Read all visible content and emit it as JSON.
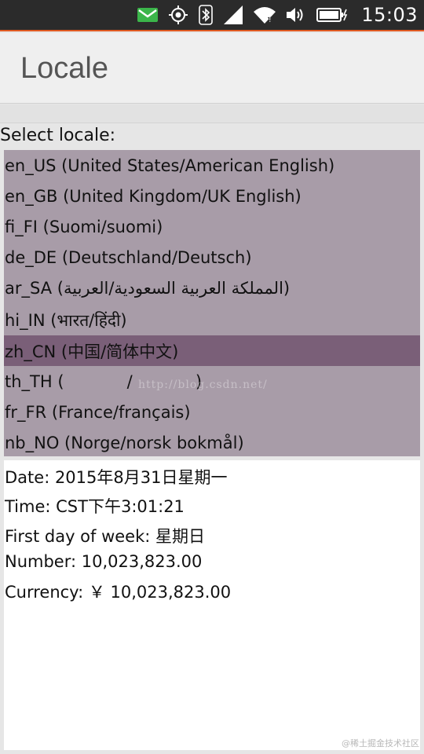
{
  "status_bar": {
    "time": "15:03",
    "icons": [
      "message-icon",
      "location-icon",
      "bluetooth-icon",
      "signal-icon",
      "wifi-icon",
      "volume-icon",
      "battery-icon"
    ],
    "message_color": "#3bb54a"
  },
  "header": {
    "title": "Locale"
  },
  "select_label": "Select locale:",
  "locales": [
    {
      "label": "en_US (United States/American English)"
    },
    {
      "label": "en_GB (United Kingdom/UK English)"
    },
    {
      "label": "fi_FI (Suomi/suomi)"
    },
    {
      "label": "de_DE (Deutschland/Deutsch)"
    },
    {
      "label": "ar_SA (المملكة العربية السعودية/العربية)"
    },
    {
      "label": "hi_IN (भारत/हिंदी)"
    },
    {
      "label": "zh_CN (中国/简体中文)",
      "selected": true
    },
    {
      "label": "th_TH (            /            )"
    },
    {
      "label": "fr_FR (France/français)"
    },
    {
      "label": "nb_NO (Norge/norsk bokmål)"
    }
  ],
  "info": {
    "date": "Date: 2015年8月31日星期一",
    "time": "Time: CST下午3:01:21",
    "first_day": "First day of week: 星期日",
    "number": "Number: 10,023,823.00",
    "currency": "Currency: ￥ 10,023,823.00"
  },
  "watermark": "http://blog.csdn.net/",
  "corner_watermark": "@稀土掘金技术社区",
  "colors": {
    "list_background": "#a89ca8",
    "selected_item": "#7a5f78",
    "status_bar": "#2b2b2b",
    "accent": "#e05a22"
  }
}
